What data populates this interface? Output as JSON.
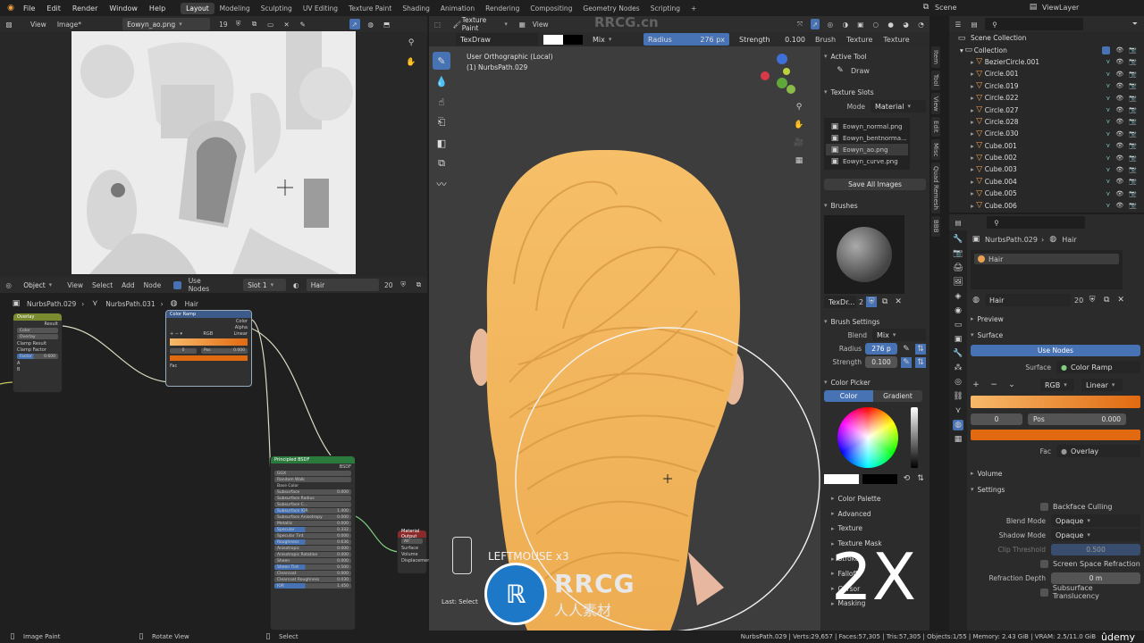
{
  "topbar": {
    "menus": [
      "File",
      "Edit",
      "Render",
      "Window",
      "Help"
    ],
    "workspaces": [
      "Layout",
      "Modeling",
      "Sculpting",
      "UV Editing",
      "Texture Paint",
      "Shading",
      "Animation",
      "Rendering",
      "Compositing",
      "Geometry Nodes",
      "Scripting"
    ],
    "active_workspace": "Layout",
    "add_tab": "+",
    "scene": "Scene",
    "view_layer": "ViewLayer"
  },
  "image_editor": {
    "view_menu": "View",
    "image_menu": "Image*",
    "image_name": "Eowyn_ao.png",
    "users": "19"
  },
  "node_editor": {
    "mode": "Object",
    "menus": [
      "View",
      "Select",
      "Add",
      "Node"
    ],
    "use_nodes": "Use Nodes",
    "slot": "Slot 1",
    "material": "Hair",
    "users": "20",
    "breadcrumb": [
      "NurbsPath.029",
      "NurbsPath.031",
      "Hair"
    ],
    "overlay_node": {
      "title": "Overlay",
      "out": "Result",
      "rows": [
        "Color",
        "Overlay",
        "Clamp Result",
        "Clamp Factor"
      ],
      "factor_label": "Factor",
      "factor_value": "0.600",
      "inputs": [
        "A",
        "B"
      ]
    },
    "color_ramp_node": {
      "title": "Color Ramp",
      "outputs": [
        "Color",
        "Alpha"
      ],
      "mode": "RGB",
      "interp": "Linear",
      "index": "0",
      "pos_label": "Pos",
      "pos_value": "0.000",
      "fac": "Fac"
    },
    "bsdf_node": {
      "title": "Principled BSDF",
      "out": "BSDF",
      "distribution": "GGX",
      "sss": "Random Walk",
      "rows": [
        {
          "label": "Base Color",
          "value": ""
        },
        {
          "label": "Subsurface",
          "value": "0.000"
        },
        {
          "label": "Subsurface Radius",
          "value": ""
        },
        {
          "label": "Subsurface C...",
          "value": ""
        },
        {
          "label": "Subsurface IOR",
          "value": "1.400"
        },
        {
          "label": "Subsurface Anisotropy",
          "value": "0.000"
        },
        {
          "label": "Metallic",
          "value": "0.000"
        },
        {
          "label": "Specular",
          "value": "0.332"
        },
        {
          "label": "Specular Tint",
          "value": "0.000"
        },
        {
          "label": "Roughness",
          "value": "0.636"
        },
        {
          "label": "Anisotropic",
          "value": "0.000"
        },
        {
          "label": "Anisotropic Rotation",
          "value": "0.000"
        },
        {
          "label": "Sheen",
          "value": "0.000"
        },
        {
          "label": "Sheen Tint",
          "value": "0.500"
        },
        {
          "label": "Clearcoat",
          "value": "0.000"
        },
        {
          "label": "Clearcoat Roughness",
          "value": "0.030"
        },
        {
          "label": "IOR",
          "value": "1.450"
        }
      ]
    },
    "output_node": {
      "title": "Material Output",
      "target": "All",
      "rows": [
        "Surface",
        "Volume",
        "Displacement"
      ]
    }
  },
  "viewport": {
    "mode": "Texture Paint",
    "view": "View",
    "brush": "TexDraw",
    "blend": "Mix",
    "radius_label": "Radius",
    "radius_value": "276 px",
    "strength_label": "Strength",
    "strength_value": "0.100",
    "brush_menu": "Brush",
    "texture_menu": "Texture",
    "texture_trunc": "Texture",
    "info_line1": "User Orthographic (Local)",
    "info_line2": "(1) NurbsPath.029",
    "overlay_text": "LEFTMOUSE x3",
    "big_overlay": "2X",
    "last_op": "Last: Select",
    "watermark": "RRCG.cn",
    "logo_main": "RRCG",
    "logo_sub": "人人素材"
  },
  "sidebar": {
    "tabs": [
      "Item",
      "Tool",
      "View",
      "Edit",
      "Misc",
      "Quad Remesh",
      "BBB"
    ],
    "active_tool": "Active Tool",
    "draw": "Draw",
    "texture_slots": "Texture Slots",
    "mode_label": "Mode",
    "mode_value": "Material",
    "slots": [
      "Eowyn_normal.png",
      "Eowyn_bentnorma...",
      "Eowyn_ao.png",
      "Eowyn_curve.png"
    ],
    "save_all": "Save All Images",
    "brushes": "Brushes",
    "brush_name": "TexDr...",
    "brush_users": "2",
    "brush_settings": "Brush Settings",
    "blend_label": "Blend",
    "blend_value": "Mix",
    "radius_label": "Radius",
    "radius_value": "276 p",
    "strength_label": "Strength",
    "strength_value": "0.100",
    "color_picker": "Color Picker",
    "color_tab": "Color",
    "gradient_tab": "Gradient",
    "collapsed": [
      "Color Palette",
      "Advanced",
      "Texture",
      "Texture Mask",
      "Stroke",
      "Falloff",
      "Cursor",
      "Masking"
    ]
  },
  "outliner": {
    "scene_collection": "Scene Collection",
    "collection": "Collection",
    "items": [
      "BezierCircle.001",
      "Circle.001",
      "Circle.019",
      "Circle.022",
      "Circle.027",
      "Circle.028",
      "Circle.030",
      "Cube.001",
      "Cube.002",
      "Cube.003",
      "Cube.004",
      "Cube.005",
      "Cube.006"
    ]
  },
  "properties": {
    "object": "NurbsPath.029",
    "material": "Hair",
    "slot": "Hair",
    "mat_field": "Hair",
    "users": "20",
    "preview": "Preview",
    "surface": "Surface",
    "use_nodes": "Use Nodes",
    "surface_label": "Surface",
    "surface_value": "Color Ramp",
    "ramp_mode": "RGB",
    "ramp_interp": "Linear",
    "index": "0",
    "pos_label": "Pos",
    "pos_value": "0.000",
    "fac_label": "Fac",
    "fac_value": "Overlay",
    "volume": "Volume",
    "settings": "Settings",
    "backface": "Backface Culling",
    "blend_mode_label": "Blend Mode",
    "blend_mode_value": "Opaque",
    "shadow_mode_label": "Shadow Mode",
    "shadow_mode_value": "Opaque",
    "clip_label": "Clip Threshold",
    "clip_value": "0.500",
    "ssr": "Screen Space Refraction",
    "refraction_label": "Refraction Depth",
    "refraction_value": "0 m",
    "sss_translucency": "Subsurface Translucency"
  },
  "status": {
    "left": [
      "Image Paint",
      "Rotate View",
      "Select"
    ],
    "right": "NurbsPath.029 | Verts:29,657 | Faces:57,305 | Tris:57,305 | Objects:1/55 | Memory: 2.43 GiB | VRAM: 2.5/11.0 GiB",
    "udemy": "ûdemy"
  },
  "colors": {
    "accent": "#4772b3",
    "hair": "#f2b65c",
    "ramp_start": "#f7b96a",
    "ramp_end": "#e16a10"
  }
}
